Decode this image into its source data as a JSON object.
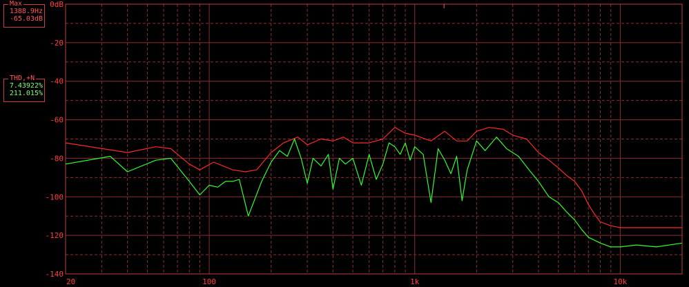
{
  "readouts": {
    "max": {
      "title": "Max",
      "freq": "1388.9Hz",
      "level": "-65.03dB"
    },
    "thd": {
      "title": "THD,+N",
      "pct1": "7.43922%",
      "pct2": "211.015%"
    }
  },
  "colors": {
    "background": "#000000",
    "grid": "#8a3030",
    "axis_text": "#ff4040",
    "series_max": "#ff2a2a",
    "series_thd": "#30ff30"
  },
  "chart_data": {
    "type": "line",
    "title": "",
    "xlabel": "",
    "ylabel": "",
    "x_scale": "log",
    "xlim": [
      20,
      20000
    ],
    "ylim": [
      -140,
      0
    ],
    "grid": true,
    "x_ticks": [
      {
        "value": 20,
        "label": "20"
      },
      {
        "value": 100,
        "label": "100"
      },
      {
        "value": 1000,
        "label": "1k"
      },
      {
        "value": 10000,
        "label": "10k"
      }
    ],
    "y_ticks": [
      {
        "value": 0,
        "label": "0dB"
      },
      {
        "value": -20,
        "label": "-20"
      },
      {
        "value": -40,
        "label": "-40"
      },
      {
        "value": -60,
        "label": "-60"
      },
      {
        "value": -80,
        "label": "-80"
      },
      {
        "value": -100,
        "label": "-100"
      },
      {
        "value": -120,
        "label": "-120"
      },
      {
        "value": -140,
        "label": "-140"
      }
    ],
    "marker": {
      "x": 1388.9
    },
    "series": [
      {
        "color": "#ff2a2a",
        "points": [
          [
            20,
            -72
          ],
          [
            40,
            -77
          ],
          [
            55,
            -74
          ],
          [
            65,
            -75
          ],
          [
            80,
            -83
          ],
          [
            90,
            -86
          ],
          [
            105,
            -82
          ],
          [
            130,
            -86
          ],
          [
            150,
            -87
          ],
          [
            170,
            -86
          ],
          [
            200,
            -77
          ],
          [
            230,
            -72
          ],
          [
            270,
            -69
          ],
          [
            300,
            -73
          ],
          [
            350,
            -70
          ],
          [
            400,
            -71
          ],
          [
            450,
            -69
          ],
          [
            500,
            -72
          ],
          [
            600,
            -72
          ],
          [
            700,
            -70
          ],
          [
            800,
            -64
          ],
          [
            900,
            -67
          ],
          [
            1000,
            -68
          ],
          [
            1200,
            -71
          ],
          [
            1400,
            -66
          ],
          [
            1600,
            -71
          ],
          [
            1800,
            -71
          ],
          [
            2000,
            -66
          ],
          [
            2300,
            -64
          ],
          [
            2700,
            -65
          ],
          [
            3000,
            -68
          ],
          [
            3500,
            -70
          ],
          [
            4000,
            -77
          ],
          [
            4500,
            -81
          ],
          [
            5000,
            -85
          ],
          [
            5500,
            -89
          ],
          [
            6000,
            -92
          ],
          [
            6500,
            -97
          ],
          [
            7000,
            -104
          ],
          [
            7500,
            -109
          ],
          [
            8000,
            -113
          ],
          [
            9000,
            -115
          ],
          [
            10000,
            -116
          ],
          [
            12000,
            -116
          ],
          [
            15000,
            -116
          ],
          [
            20000,
            -116
          ]
        ]
      },
      {
        "color": "#30ff30",
        "points": [
          [
            20,
            -83
          ],
          [
            33,
            -79
          ],
          [
            40,
            -87
          ],
          [
            55,
            -81
          ],
          [
            65,
            -80
          ],
          [
            80,
            -92
          ],
          [
            90,
            -99
          ],
          [
            100,
            -94
          ],
          [
            110,
            -95
          ],
          [
            120,
            -92
          ],
          [
            130,
            -92
          ],
          [
            140,
            -91
          ],
          [
            155,
            -110
          ],
          [
            180,
            -92
          ],
          [
            200,
            -82
          ],
          [
            220,
            -76
          ],
          [
            240,
            -79
          ],
          [
            260,
            -70
          ],
          [
            280,
            -80
          ],
          [
            300,
            -93
          ],
          [
            320,
            -80
          ],
          [
            350,
            -84
          ],
          [
            380,
            -78
          ],
          [
            400,
            -96
          ],
          [
            430,
            -80
          ],
          [
            460,
            -83
          ],
          [
            500,
            -80
          ],
          [
            550,
            -94
          ],
          [
            600,
            -78
          ],
          [
            650,
            -91
          ],
          [
            700,
            -83
          ],
          [
            750,
            -72
          ],
          [
            800,
            -74
          ],
          [
            850,
            -78
          ],
          [
            900,
            -72
          ],
          [
            950,
            -81
          ],
          [
            1000,
            -74
          ],
          [
            1100,
            -78
          ],
          [
            1200,
            -103
          ],
          [
            1300,
            -75
          ],
          [
            1400,
            -81
          ],
          [
            1500,
            -88
          ],
          [
            1600,
            -79
          ],
          [
            1700,
            -102
          ],
          [
            1800,
            -86
          ],
          [
            2000,
            -71
          ],
          [
            2200,
            -76
          ],
          [
            2500,
            -69
          ],
          [
            2800,
            -75
          ],
          [
            3200,
            -79
          ],
          [
            3600,
            -86
          ],
          [
            4000,
            -92
          ],
          [
            4500,
            -100
          ],
          [
            5000,
            -103
          ],
          [
            5500,
            -108
          ],
          [
            6000,
            -112
          ],
          [
            6500,
            -117
          ],
          [
            7000,
            -121
          ],
          [
            8000,
            -124
          ],
          [
            9000,
            -126
          ],
          [
            10000,
            -126
          ],
          [
            12000,
            -125
          ],
          [
            15000,
            -126
          ],
          [
            20000,
            -124
          ]
        ]
      }
    ]
  }
}
